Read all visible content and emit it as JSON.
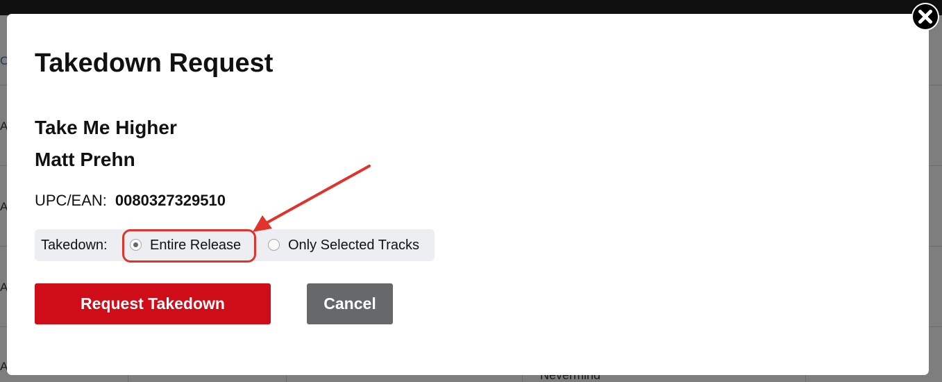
{
  "background": {
    "row_fragments": [
      {
        "text": "Ca",
        "link": true
      },
      {
        "text": "A"
      },
      {
        "text": "A"
      },
      {
        "text": "A"
      },
      {
        "text": "A"
      }
    ],
    "cell_text": "Nevermind"
  },
  "modal": {
    "title": "Takedown Request",
    "release_title": "Take Me Higher",
    "artist": "Matt Prehn",
    "upc_label": "UPC/EAN:",
    "upc_value": "0080327329510",
    "takedown": {
      "label": "Takedown:",
      "options": [
        {
          "label": "Entire Release",
          "selected": true
        },
        {
          "label": "Only Selected Tracks",
          "selected": false
        }
      ]
    },
    "buttons": {
      "primary_label": "Request Takedown",
      "cancel_label": "Cancel"
    },
    "close_icon": "close-icon"
  },
  "annotation": {
    "color": "#e0332b",
    "target": "Entire Release"
  },
  "colors": {
    "primary_button": "#cf0d18",
    "cancel_button": "#666869",
    "takedown_box": "#eceef1"
  }
}
